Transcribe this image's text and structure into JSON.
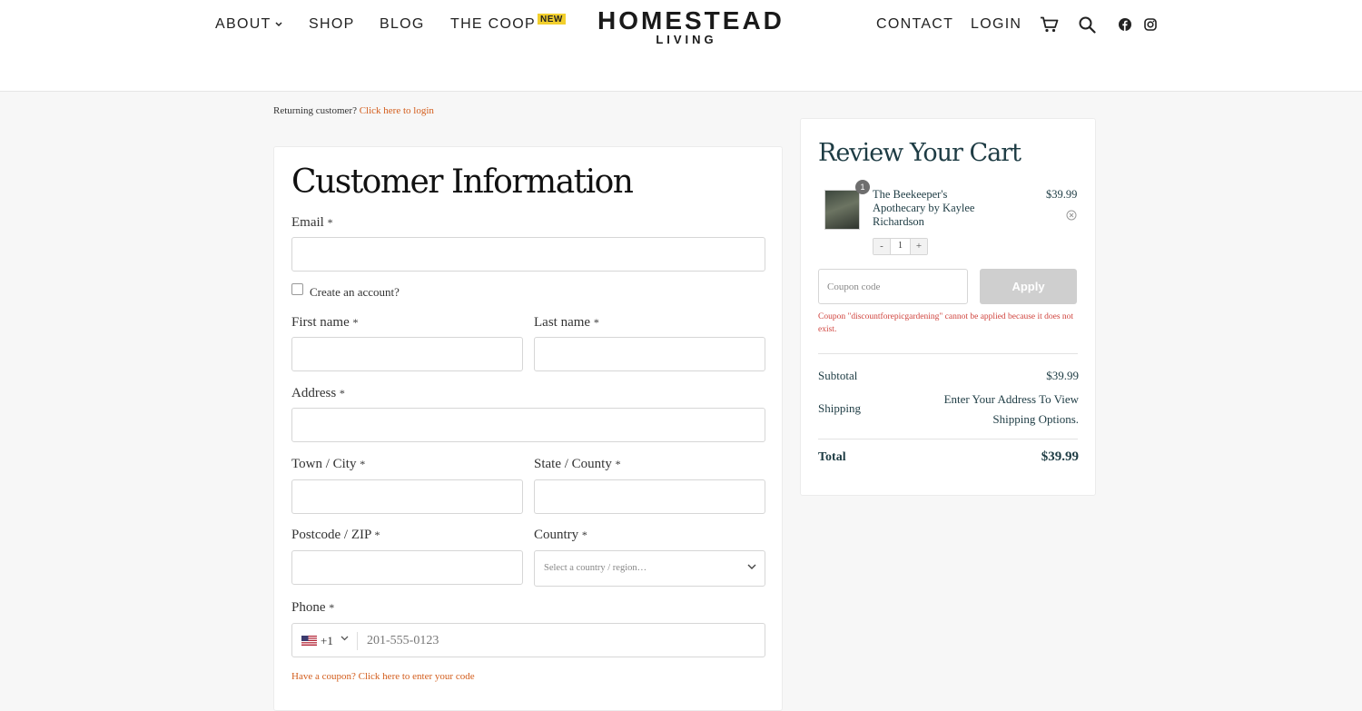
{
  "header": {
    "nav_left": [
      "ABOUT",
      "SHOP",
      "BLOG",
      "THE COOP"
    ],
    "new_badge": "NEW",
    "logo_main": "HOMESTEAD",
    "logo_sub": "LIVING",
    "nav_right": [
      "CONTACT",
      "LOGIN"
    ],
    "icons": [
      "cart-icon",
      "search-icon",
      "facebook-icon",
      "instagram-icon"
    ]
  },
  "returning": {
    "text": "Returning customer?",
    "link": "Click here to login"
  },
  "customer": {
    "title": "Customer Information",
    "email_label": "Email",
    "create_account": "Create an account?",
    "first_name_label": "First name",
    "last_name_label": "Last name",
    "address_label": "Address",
    "city_label": "Town / City",
    "state_label": "State / County",
    "postcode_label": "Postcode / ZIP",
    "country_label": "Country",
    "country_placeholder": "Select a country / region…",
    "phone_label": "Phone",
    "dial_code": "+1",
    "phone_placeholder": "201-555-0123",
    "coupon_link": "Have a coupon? Click here to enter your code",
    "required_mark": "*"
  },
  "cart": {
    "title": "Review Your Cart",
    "item": {
      "name": "The Beekeeper's Apothecary by Kaylee Richardson",
      "price": "$39.99",
      "qty_badge": "1",
      "qty": "1",
      "minus": "-",
      "plus": "+"
    },
    "coupon_placeholder": "Coupon code",
    "apply_label": "Apply",
    "coupon_error": "Coupon \"discountforepicgardening\" cannot be applied because it does not exist.",
    "subtotal_label": "Subtotal",
    "subtotal_value": "$39.99",
    "shipping_label": "Shipping",
    "shipping_value": "Enter Your Address To View Shipping Options.",
    "total_label": "Total",
    "total_value": "$39.99"
  },
  "colors": {
    "accent_orange": "#d35d1c",
    "heading_teal": "#1e3c44",
    "error_red": "#d0443e",
    "badge_yellow": "#f2cf2d"
  }
}
